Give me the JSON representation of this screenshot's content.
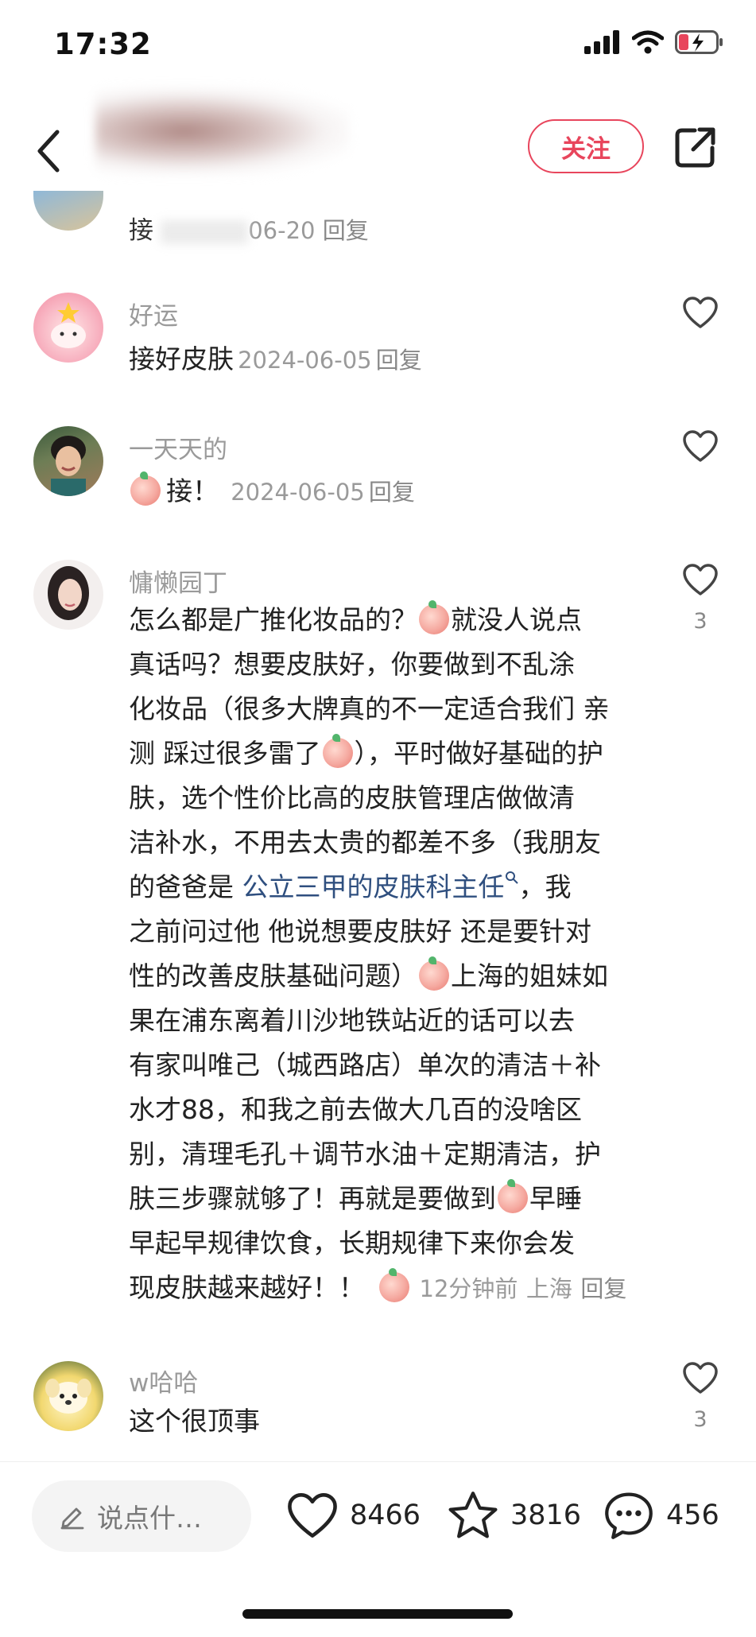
{
  "status_bar": {
    "time": "17:32"
  },
  "header": {
    "follow_label": "关注"
  },
  "partial_comment": {
    "first_char": "接",
    "date_tail": "06-20",
    "reply": "回复"
  },
  "comments": [
    {
      "name": "好运",
      "text": "接好皮肤",
      "date": "2024-06-05",
      "reply": "回复"
    },
    {
      "name": "一天天的",
      "text": "接！",
      "date": "2024-06-05",
      "reply": "回复"
    },
    {
      "name": "慵懒园丁",
      "lines": [
        "怎么都是广推化妆品的？",
        "就没人说点",
        "真话吗？想要皮肤好，你要做到不乱涂",
        "化妆品（很多大牌真的不一定适合我们 亲",
        "测 踩过很多雷了",
        "），平时做好基础的护",
        "肤，选个性价比高的皮肤管理店做做清",
        "洁补水，不用去太贵的都差不多（我朋友",
        "的爸爸是 ",
        "公立三甲的皮肤科主任",
        "，我",
        "之前问过他 他说想要皮肤好 还是要针对",
        "性的改善皮肤基础问题）",
        "上海的姐妹如",
        "果在浦东离着川沙地铁站近的话可以去",
        "有家叫唯己（城西路店）单次的清洁＋补",
        "水才88，和我之前去做大几百的没啥区",
        "别，清理毛孔＋调节水油＋定期清洁，护",
        "肤三步骤就够了！再就是要做到",
        "早睡",
        "早起早规律饮食，长期规律下来你会发",
        "现皮肤越来越好！！"
      ],
      "time": "12分钟前",
      "location": "上海",
      "reply": "回复",
      "likes": "3"
    },
    {
      "name": "w哈哈",
      "text": "这个很顶事",
      "likes": "3"
    }
  ],
  "bottom_bar": {
    "input_placeholder": "说点什…",
    "likes": "8466",
    "favorites": "3816",
    "comments": "456"
  },
  "colors": {
    "accent": "#e8455c",
    "link": "#2f4f7f",
    "muted": "#9a9a9a"
  }
}
